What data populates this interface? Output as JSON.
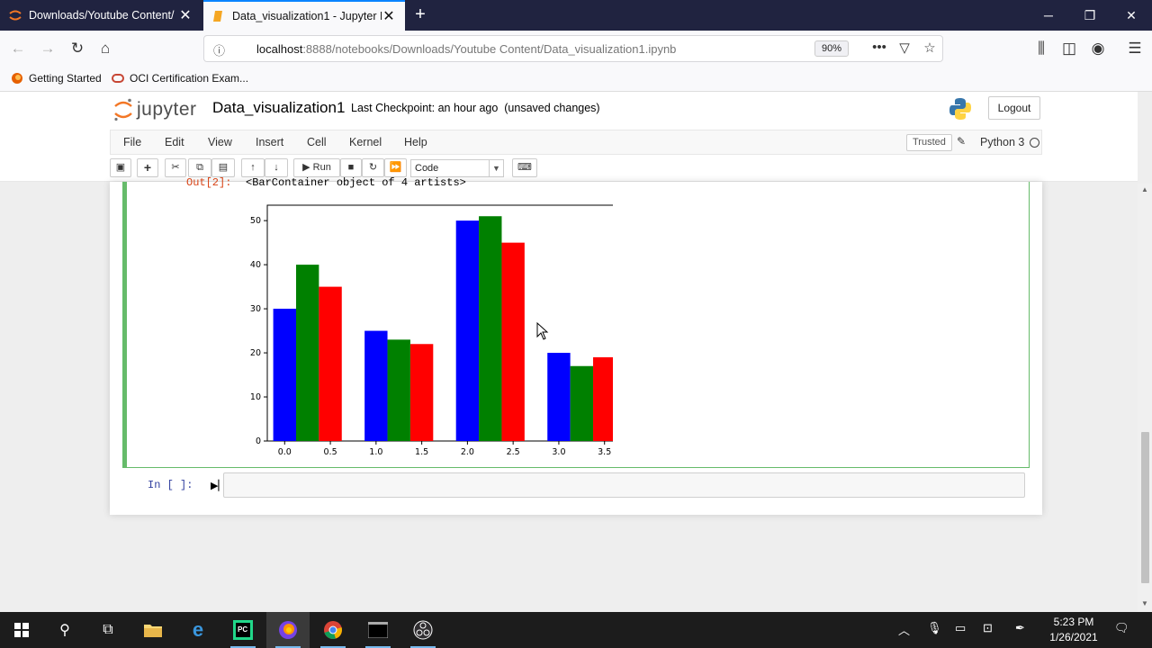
{
  "browser": {
    "tabs": [
      {
        "title": "Downloads/Youtube Content/",
        "active": false
      },
      {
        "title": "Data_visualization1 - Jupyter N",
        "active": true
      }
    ],
    "url_host": "localhost",
    "url_rest": ":8888/notebooks/Downloads/Youtube Content/Data_visualization1.ipynb",
    "zoom": "90%",
    "bookmarks": [
      "Getting Started",
      "OCI Certification Exam..."
    ]
  },
  "jupyter": {
    "logo_text": "jupyter",
    "notebook_name": "Data_visualization1",
    "checkpoint": "Last Checkpoint: an hour ago",
    "unsaved": "(unsaved changes)",
    "logout_label": "Logout",
    "menu": [
      "File",
      "Edit",
      "View",
      "Insert",
      "Cell",
      "Kernel",
      "Help"
    ],
    "trusted_label": "Trusted",
    "kernel_name": "Python 3",
    "run_label": "Run",
    "cell_type": "Code",
    "out_prompt": "Out[2]:",
    "out_text": "<BarContainer object of 4 artists>",
    "in_prompt": "In [ ]:"
  },
  "chart_data": {
    "type": "bar",
    "series": [
      {
        "color": "#0000ff",
        "x": [
          0.0,
          1.0,
          2.0,
          3.0
        ],
        "values": [
          30,
          25,
          50,
          20
        ]
      },
      {
        "color": "#008000",
        "x": [
          0.25,
          1.25,
          2.25,
          3.25
        ],
        "values": [
          40,
          23,
          51,
          17
        ]
      },
      {
        "color": "#ff0000",
        "x": [
          0.5,
          1.5,
          2.5,
          3.5
        ],
        "values": [
          35,
          22,
          45,
          19
        ]
      }
    ],
    "bar_width": 0.25,
    "xticks": [
      "0.0",
      "0.5",
      "1.0",
      "1.5",
      "2.0",
      "2.5",
      "3.0",
      "3.5"
    ],
    "yticks": [
      "0",
      "10",
      "20",
      "30",
      "40",
      "50"
    ],
    "xlim": [
      -0.19,
      3.69
    ],
    "ylim": [
      0,
      53.5
    ],
    "grid": false
  },
  "taskbar": {
    "time": "5:23 PM",
    "date": "1/26/2021"
  }
}
